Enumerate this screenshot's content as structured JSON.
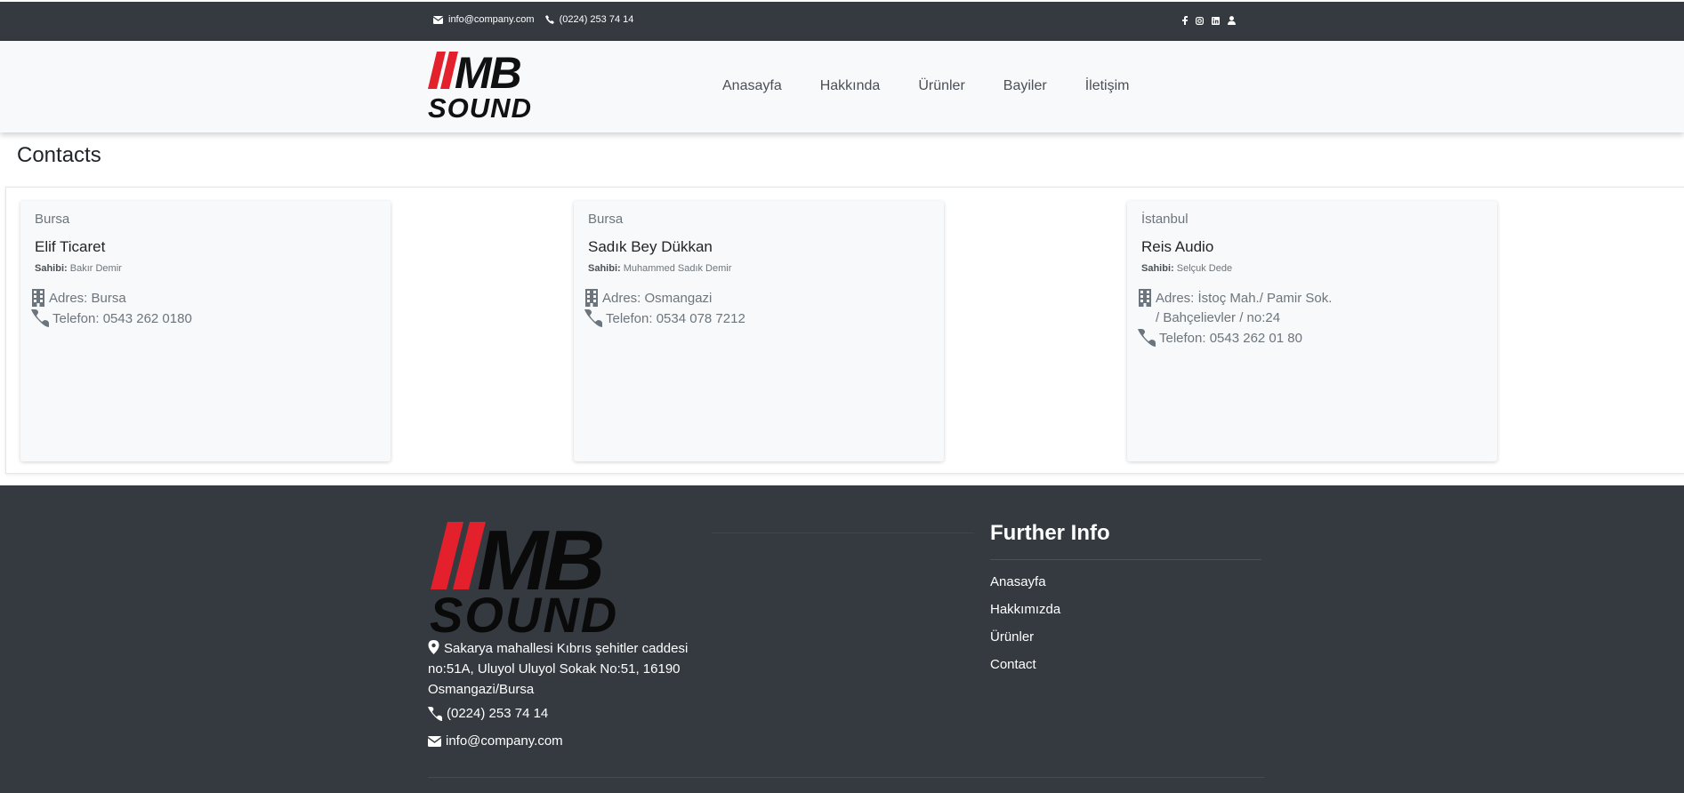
{
  "topbar": {
    "email": "info@company.com",
    "phone": "(0224) 253 74 14",
    "social_icons": [
      "facebook-icon",
      "instagram-icon",
      "linkedin-icon",
      "user-icon"
    ]
  },
  "brand": {
    "logo_text_top": "MB",
    "logo_text_bottom": "SOUND"
  },
  "nav": {
    "items": [
      {
        "label": "Anasayfa"
      },
      {
        "label": "Hakkında"
      },
      {
        "label": "Ürünler"
      },
      {
        "label": "Bayiler"
      },
      {
        "label": "İletişim"
      }
    ]
  },
  "page": {
    "title": "Contacts"
  },
  "owner_label": "Sahibi:",
  "cards": [
    {
      "city": "Bursa",
      "name": "Elif Ticaret",
      "owner": "Bakır Demir",
      "address_lines": [
        "Adres: Bursa"
      ],
      "phone": "Telefon: 0543 262 0180"
    },
    {
      "city": "Bursa",
      "name": "Sadık Bey Dükkan",
      "owner": "Muhammed Sadık Demir",
      "address_lines": [
        "Adres: Osmangazi"
      ],
      "phone": "Telefon: 0534 078 7212"
    },
    {
      "city": "İstanbul",
      "name": "Reis Audio",
      "owner": "Selçuk Dede",
      "address_lines": [
        "Adres: İstoç Mah./ Pamir Sok.",
        "/ Bahçelievler / no:24"
      ],
      "phone": "Telefon: 0543 262 01 80"
    }
  ],
  "footer": {
    "address": "Sakarya mahallesi Kıbrıs şehitler caddesi no:51A, Uluyol Uluyol Sokak No:51, 16190 Osmangazi/Bursa",
    "phone": "(0224) 253 74 14",
    "email": "info@company.com",
    "further_info_title": "Further Info",
    "links": [
      {
        "label": "Anasayfa"
      },
      {
        "label": "Hakkımızda"
      },
      {
        "label": "Ürünler"
      },
      {
        "label": "Contact"
      }
    ]
  },
  "colors": {
    "dark": "#343a40",
    "accent_red": "#e3202b",
    "light": "#f8f9fa"
  }
}
